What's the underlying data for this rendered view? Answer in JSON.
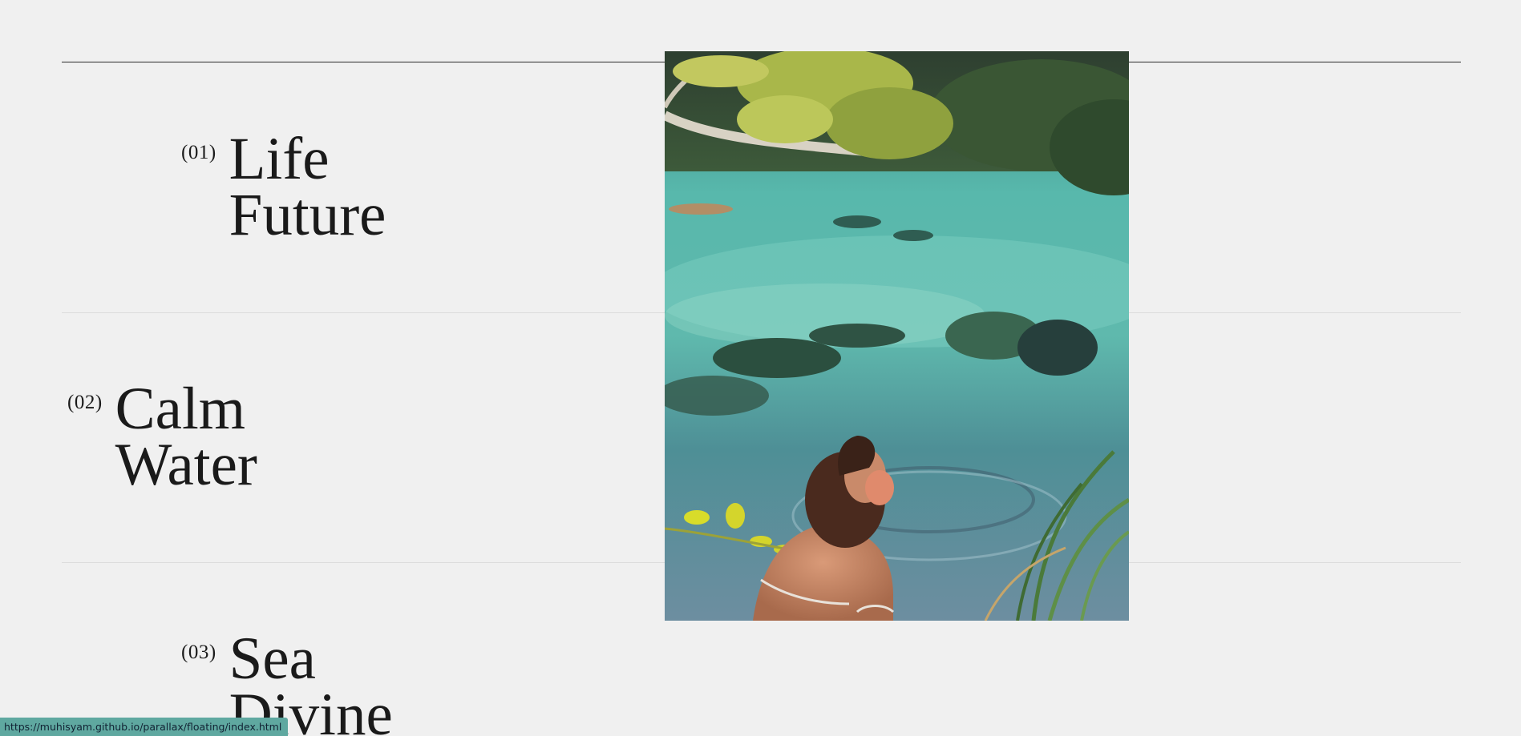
{
  "items": [
    {
      "number": "(01)",
      "line1": "Life",
      "line2": "Future"
    },
    {
      "number": "(02)",
      "line1": "Calm",
      "line2": "Water"
    },
    {
      "number": "(03)",
      "line1": "Sea",
      "line2": "Divine"
    }
  ],
  "photo": {
    "subject": "woman sitting by clear turquoise lagoon under tree"
  },
  "status_bar": {
    "url": "https://muhisyam.github.io/parallax/floating/index.html"
  },
  "colors": {
    "background": "#f0f0f0",
    "text": "#1a1a1a",
    "rule_dark": "#2a2a2a",
    "rule_light": "#dcdcdc",
    "status_bg": "#5fa8a0"
  }
}
